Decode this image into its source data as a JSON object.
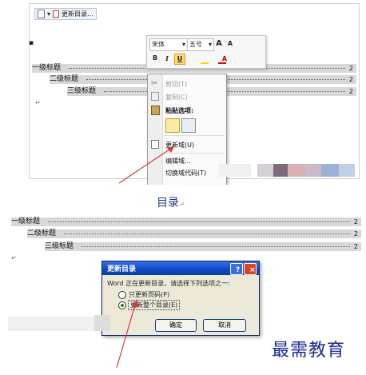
{
  "panel1": {
    "content_control": {
      "label": "更新目录..."
    },
    "toc": [
      {
        "text": "一级标题",
        "page": "2"
      },
      {
        "text": "二级标题",
        "page": "2"
      },
      {
        "text": "三级标题",
        "page": "2"
      }
    ],
    "mini_toolbar": {
      "font": "宋体",
      "size": "五号",
      "row1_glyphs": [
        "A",
        "A",
        "",
        ""
      ],
      "row2_glyphs": [
        "B",
        "I",
        "U",
        "",
        "",
        "A",
        "",
        ""
      ],
      "accent_color": "#ffd400"
    },
    "context_menu": {
      "items": [
        {
          "label": "剪切(T)",
          "icon": "cut-icon",
          "enabled": false
        },
        {
          "label": "复制(C)",
          "icon": "copy-icon",
          "enabled": false
        },
        {
          "label": "粘贴选项:",
          "icon": "paste-icon",
          "enabled": true
        },
        {
          "label": "更新域(U)",
          "icon": "update-field-icon",
          "enabled": true
        },
        {
          "label": "编辑域...",
          "icon": "",
          "enabled": true
        },
        {
          "label": "切换域代码(T)",
          "icon": "",
          "enabled": true
        }
      ]
    }
  },
  "panel2": {
    "title": "目录",
    "toc": [
      {
        "text": "一级标题",
        "page": "2"
      },
      {
        "text": "二级标题",
        "page": "2"
      },
      {
        "text": "三级标题",
        "page": "2"
      }
    ]
  },
  "dialog": {
    "title": "更新目录",
    "help": "?",
    "close": "×",
    "prompt": "Word 正在更新目录，请选择下列选项之一:",
    "options": [
      {
        "label": "只更新页码(P)",
        "selected": false
      },
      {
        "label": "更新整个目录(E)",
        "selected": true
      }
    ],
    "ok": "确定",
    "cancel": "取消"
  },
  "watermark": "最需教育",
  "colors": {
    "arrow": "#d04040",
    "title_blue": "#1f3a8a",
    "dialog_title": "#0b48c4"
  }
}
